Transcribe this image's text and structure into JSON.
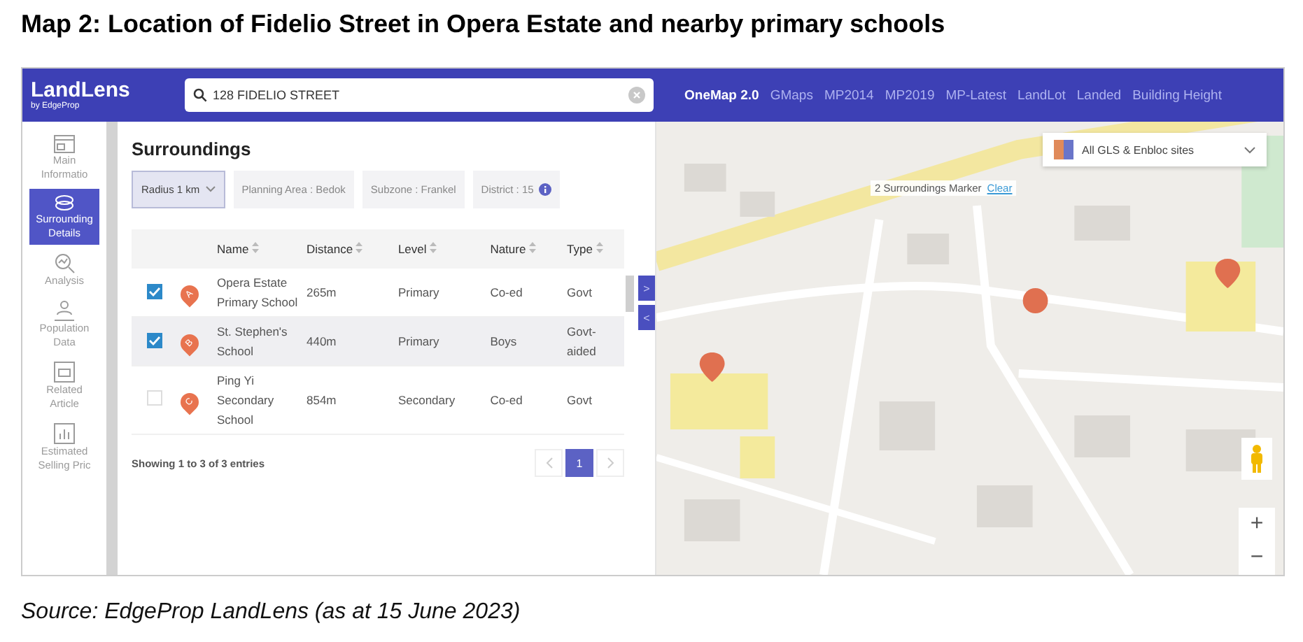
{
  "heading": "Map 2: Location of Fidelio Street in Opera Estate and nearby primary schools",
  "app": {
    "logo": "LandLens",
    "logo_sub": "by EdgeProp",
    "search": {
      "value": "128 FIDELIO STREET"
    },
    "map_tabs": [
      {
        "label": "OneMap 2.0",
        "selected": true
      },
      {
        "label": "GMaps",
        "selected": false
      },
      {
        "label": "MP2014",
        "selected": false
      },
      {
        "label": "MP2019",
        "selected": false
      },
      {
        "label": "MP-Latest",
        "selected": false
      },
      {
        "label": "LandLot",
        "selected": false
      },
      {
        "label": "Landed",
        "selected": false
      },
      {
        "label": "Building Height",
        "selected": false
      }
    ],
    "sidebar": [
      {
        "label": "Main Informatio",
        "kind": "info",
        "selected": false
      },
      {
        "label": "Surrounding Details",
        "kind": "surroundings",
        "selected": true
      },
      {
        "label": "Analysis",
        "kind": "analysis",
        "selected": false
      },
      {
        "label": "Population Data",
        "kind": "population",
        "selected": false
      },
      {
        "label": "Related Article",
        "kind": "article",
        "selected": false
      },
      {
        "label": "Estimated Selling Pric",
        "kind": "price",
        "selected": false
      }
    ],
    "panel": {
      "title": "Surroundings",
      "filters": [
        {
          "label": "Radius 1 km",
          "kind": "dropdown"
        },
        {
          "label": "Planning Area : Bedok",
          "kind": "tag"
        },
        {
          "label": "Subzone : Frankel",
          "kind": "tag"
        },
        {
          "label": "District : 15",
          "kind": "info"
        }
      ],
      "columns": [
        "Name",
        "Distance",
        "Level",
        "Nature",
        "Type"
      ],
      "rows": [
        {
          "checked": true,
          "selected": false,
          "marker": "A",
          "name": "Opera Estate Primary School",
          "distance": "265m",
          "level": "Primary",
          "nature": "Co-ed",
          "type": "Govt"
        },
        {
          "checked": true,
          "selected": true,
          "marker": "B",
          "name": "St. Stephen's School",
          "distance": "440m",
          "level": "Primary",
          "nature": "Boys",
          "type": "Govt-aided"
        },
        {
          "checked": false,
          "selected": false,
          "marker": "C",
          "name": "Ping Yi Secondary School",
          "distance": "854m",
          "level": "Secondary",
          "nature": "Co-ed",
          "type": "Govt"
        }
      ],
      "footer": "Showing 1 to 3 of 3 entries",
      "pages": [
        {
          "label": "1",
          "selected": true
        }
      ]
    },
    "toggles": [
      ">",
      "<"
    ],
    "layer_select": "All GLS & Enbloc sites",
    "marker_info": {
      "text": "2 Surroundings Marker",
      "link": "Clear"
    },
    "zoom": [
      "+",
      "−"
    ]
  },
  "caption": "Source: EdgeProp LandLens (as at 15 June 2023)"
}
